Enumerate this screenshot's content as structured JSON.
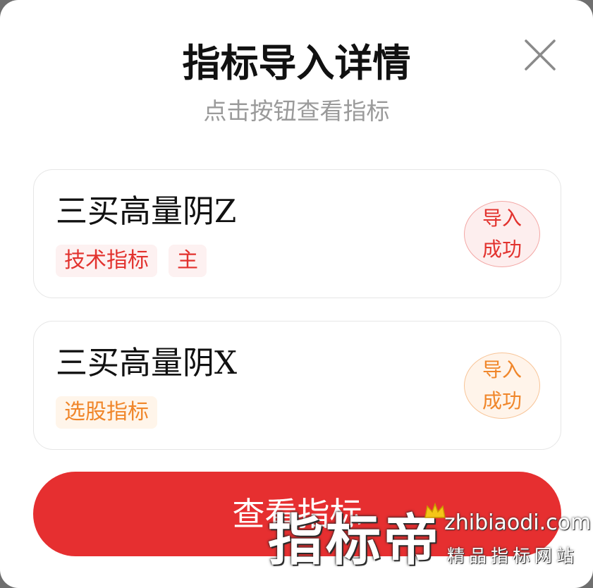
{
  "dialog": {
    "title": "指标导入详情",
    "subtitle": "点击按钮查看指标",
    "close_icon": "close-icon"
  },
  "items": [
    {
      "name": "三买高量阴Z",
      "tags": [
        "技术指标",
        "主"
      ],
      "stamp_line1": "导入",
      "stamp_line2": "成功",
      "accent": "#e2322e"
    },
    {
      "name": "三买高量阴X",
      "tags": [
        "选股指标"
      ],
      "stamp_line1": "导入",
      "stamp_line2": "成功",
      "accent": "#f0862a"
    }
  ],
  "primary_button": {
    "label": "查看指标",
    "color": "#e62f30"
  },
  "watermark": {
    "brand": "指标帝",
    "url": "zhibiaodi.com",
    "tagline": "精品指标网站",
    "icon": "crown-icon"
  }
}
